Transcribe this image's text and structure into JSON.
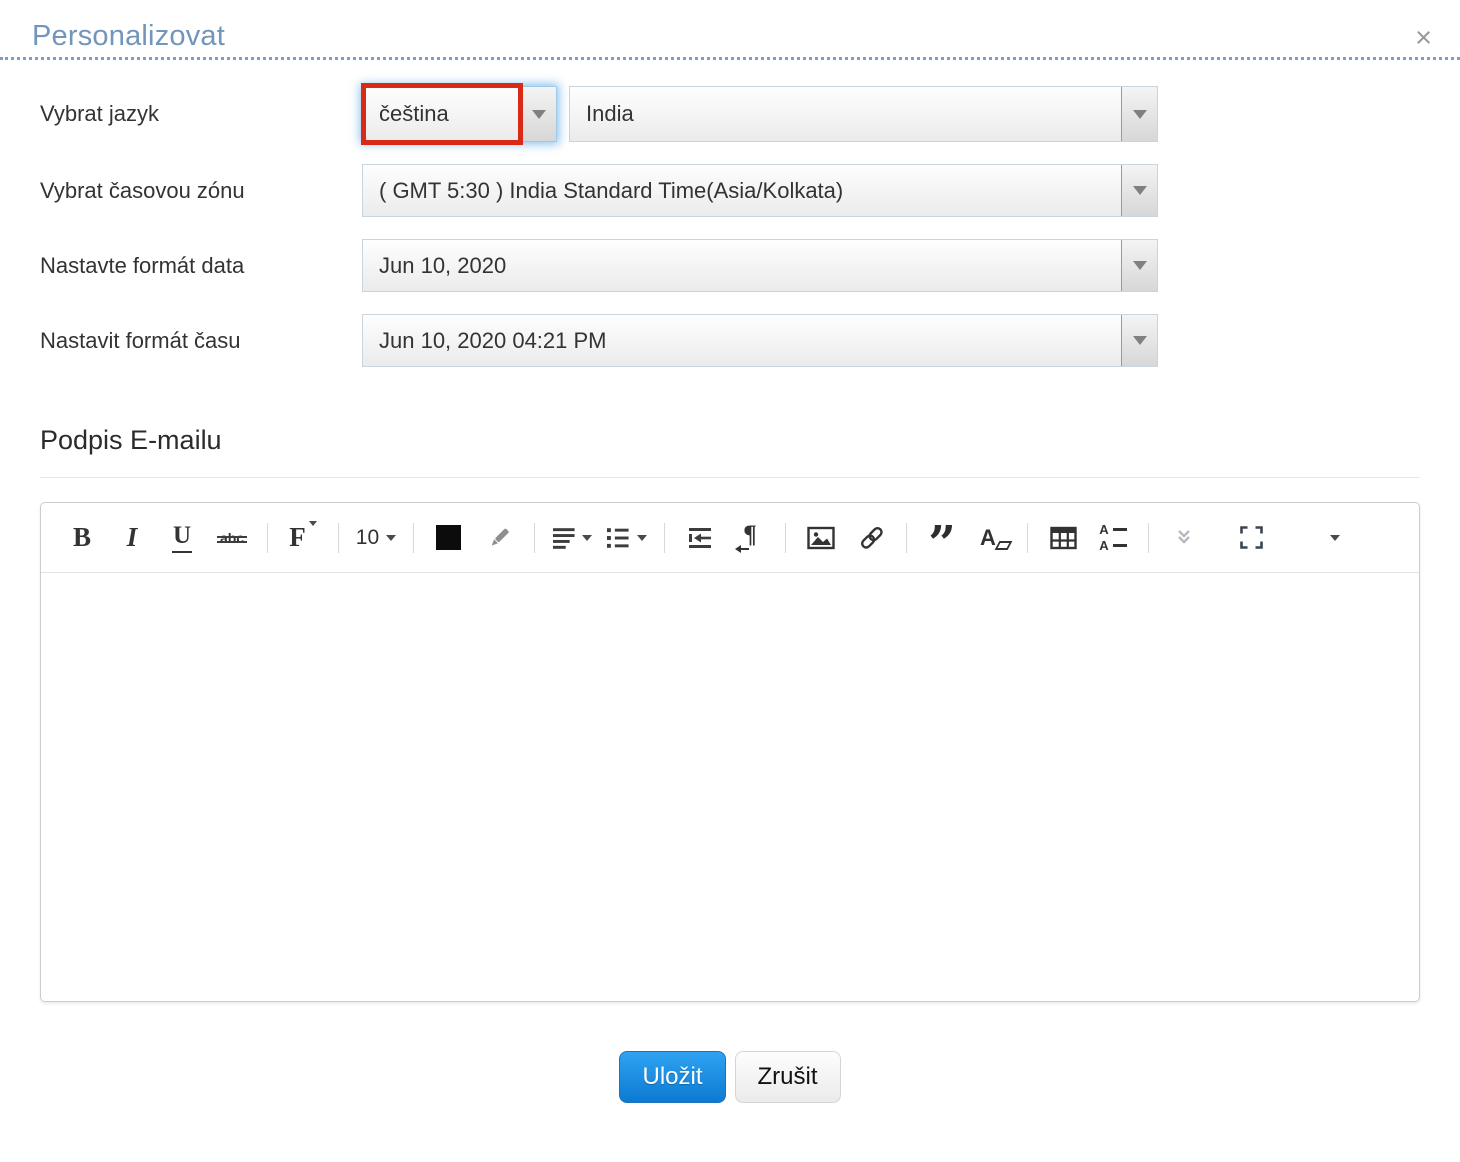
{
  "dialog": {
    "title": "Personalizovat",
    "close": "×"
  },
  "form": {
    "language": {
      "label": "Vybrat jazyk",
      "value": "čeština"
    },
    "country": {
      "value": "India"
    },
    "timezone": {
      "label": "Vybrat časovou zónu",
      "value": "( GMT 5:30 ) India Standard Time(Asia/Kolkata)"
    },
    "date_format": {
      "label": "Nastavte formát data",
      "value": "Jun 10, 2020"
    },
    "time_format": {
      "label": "Nastavit formát času",
      "value": "Jun 10, 2020 04:21 PM"
    }
  },
  "signature": {
    "heading": "Podpis E-mailu",
    "content": ""
  },
  "editor": {
    "toolbar": {
      "bold": "B",
      "italic": "I",
      "underline": "U",
      "strikethrough": "abc",
      "font": "F",
      "font_size": "10",
      "quote": "”",
      "paragraph": "¶",
      "remove_format": "A",
      "line_height_letter": "A"
    }
  },
  "actions": {
    "save": "Uložit",
    "cancel": "Zrušit"
  },
  "colors": {
    "title_blue": "#7195bb",
    "annotation_red": "#d92a18",
    "focus_glow_blue": "#48a0e4",
    "save_gradient_top": "#2fa3f2",
    "save_gradient_bottom": "#0c7ad2"
  }
}
